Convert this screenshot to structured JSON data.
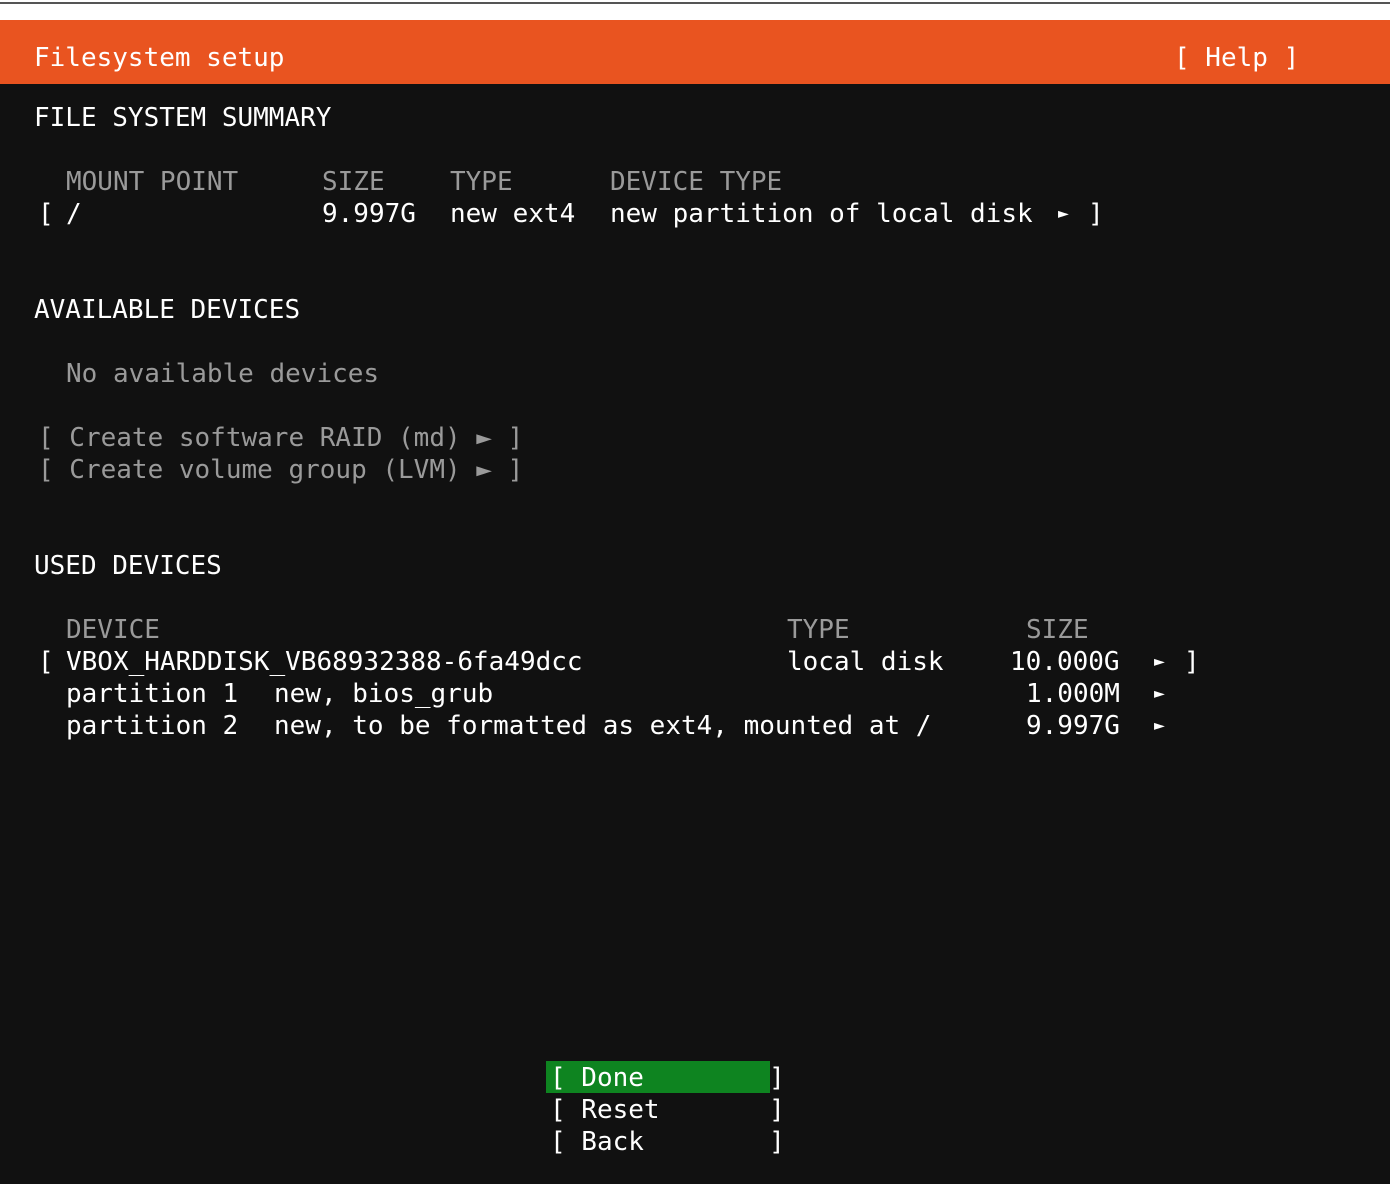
{
  "header": {
    "title": "Filesystem setup",
    "help_label": "[ Help ]",
    "color": "#e95420"
  },
  "summary": {
    "section_title": "FILE SYSTEM SUMMARY",
    "columns": {
      "mount_point": "MOUNT POINT",
      "size": "SIZE",
      "type": "TYPE",
      "device_type": "DEVICE TYPE"
    },
    "rows": [
      {
        "open_bracket": "[",
        "mount_point": "/",
        "size": "9.997G",
        "type": "new ext4",
        "device_type": "new partition of local disk",
        "arrow": "►",
        "close_bracket": "]"
      }
    ]
  },
  "available": {
    "section_title": "AVAILABLE DEVICES",
    "empty_text": "No available devices",
    "actions": [
      {
        "label": "[ Create software RAID (md) ► ]"
      },
      {
        "label": "[ Create volume group (LVM) ► ]"
      }
    ]
  },
  "used": {
    "section_title": "USED DEVICES",
    "columns": {
      "device": "DEVICE",
      "type": "TYPE",
      "size": "SIZE"
    },
    "disk": {
      "open_bracket": "[",
      "name": "VBOX_HARDDISK_VB68932388-6fa49dcc",
      "type": "local disk",
      "size": "10.000G",
      "arrow": "►",
      "close_bracket": "]"
    },
    "partitions": [
      {
        "name": "partition 1",
        "desc": "new, bios_grub",
        "size": "1.000M",
        "arrow": "►"
      },
      {
        "name": "partition 2",
        "desc": "new, to be formatted as ext4, mounted at /",
        "size": "9.997G",
        "arrow": "►"
      }
    ]
  },
  "buttons": {
    "done": "[ Done        ]",
    "reset": "[ Reset       ]",
    "back": "[ Back        ]",
    "selected_color": "#0e8420"
  }
}
